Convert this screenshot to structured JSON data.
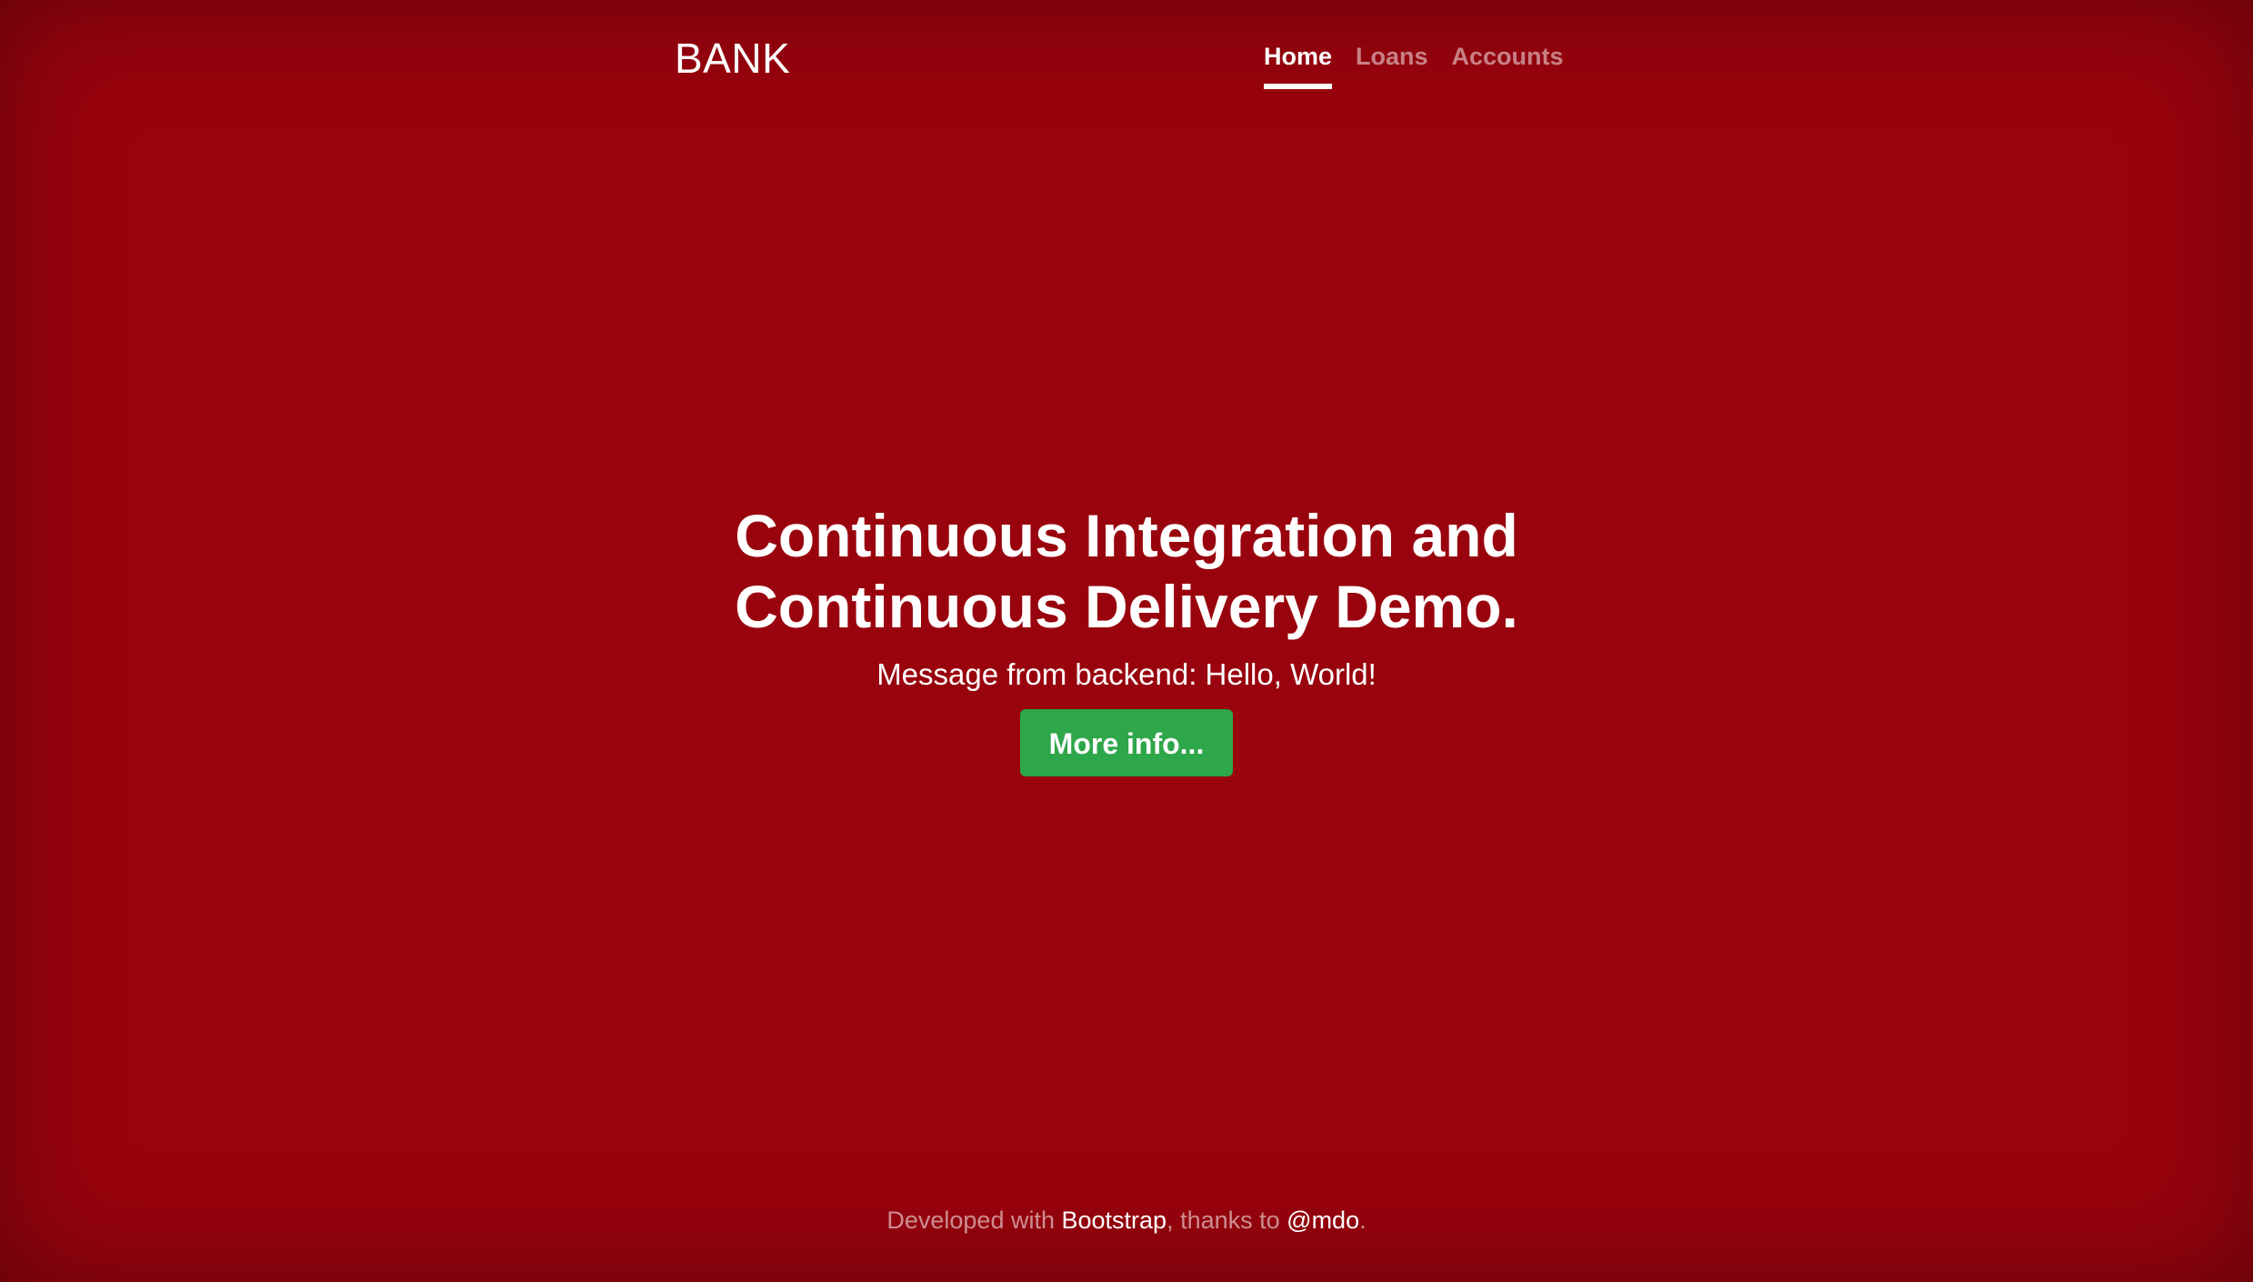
{
  "header": {
    "brand": "BANK",
    "nav": [
      {
        "label": "Home",
        "active": true
      },
      {
        "label": "Loans",
        "active": false
      },
      {
        "label": "Accounts",
        "active": false
      }
    ]
  },
  "main": {
    "heading": "Continuous Integration and Continuous Delivery Demo.",
    "message": "Message from backend: Hello, World!",
    "button_label": "More info..."
  },
  "footer": {
    "prefix": "Developed with ",
    "link1": "Bootstrap",
    "middle": ", thanks to ",
    "link2": "@mdo",
    "suffix": "."
  },
  "colors": {
    "background": "#99030d",
    "button": "#2ea64a",
    "text": "#ffffff"
  }
}
